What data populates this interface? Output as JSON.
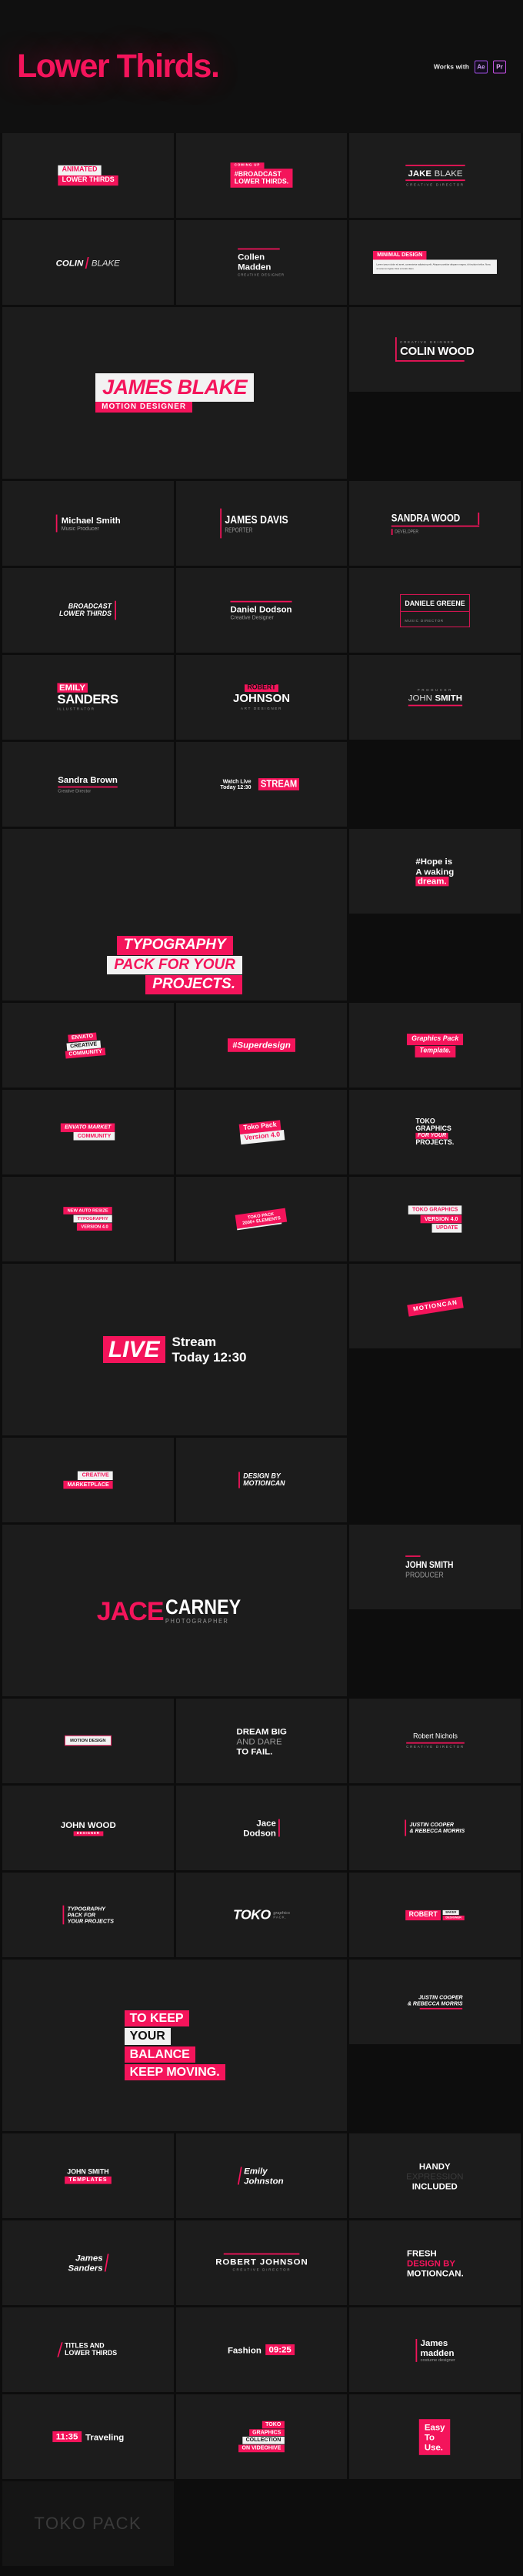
{
  "header": {
    "title": "Lower Thirds.",
    "works_with_label": "Works with",
    "badges": [
      {
        "name": "after-effects",
        "label": "Ae"
      },
      {
        "name": "premiere-pro",
        "label": "Pr"
      }
    ],
    "accent_color": "#f4145b",
    "background_color": "#0d0d0d"
  },
  "cards": {
    "animated_lower_thirds": {
      "line1": "ANIMATED",
      "line2": "LOWER THIRDS"
    },
    "broadcast_lower_thirds": {
      "kicker": "COMING UP",
      "line1": "#BROADCAST",
      "line2": "LOWER THIRDS."
    },
    "jake_blake": {
      "first": "JAKE",
      "last": "BLAKE",
      "role": "CREATIVE DIRECTOR"
    },
    "colin_blake": {
      "first": "COLIN",
      "last": "BLAKE"
    },
    "collen_madden": {
      "line1": "Collen",
      "line2": "Madden",
      "role": "CREATIVE DESIGNER"
    },
    "minimal_design": {
      "title": "MINIMAL DESIGN",
      "body": "Lorem ipsum dolor sit amet, consectetur adipiscing elit. Aliquam porttitor aliquam magna, id tincidunt tellus. Nunc sit amet ex ligula. Duis et tortor diam."
    },
    "james_blake": {
      "name": "JAMES BLAKE",
      "role": "MOTION DESIGNER"
    },
    "colin_wood": {
      "kicker": "CREATIVE DEIGNER",
      "name": "COLIN WOOD"
    },
    "michael_smith": {
      "name": "Michael Smith",
      "role": "Music Producer"
    },
    "james_davis": {
      "name": "JAMES DAVIS",
      "role": "REPORTER"
    },
    "sandra_wood": {
      "name": "SANDRA WOOD",
      "role": "DEVELOPER"
    },
    "broadcast_titles": {
      "line1": "BROADCAST",
      "line2": "LOWER THIRDS"
    },
    "daniel_dodson": {
      "name": "Daniel Dodson",
      "role": "Creative Designer"
    },
    "daniele_greene": {
      "name": "DANIELE GREENE",
      "role": "MUSIC DIRECTOR"
    },
    "emily_sanders": {
      "first": "EMILY",
      "last": "SANDERS",
      "role": "ILLUSTRATOR"
    },
    "robert_johnson_1": {
      "first": "ROBERT",
      "last": "JOHNSON",
      "role": "ART DESIGNER"
    },
    "john_smith_1": {
      "kicker": "PRODUCER",
      "first": "JOHN",
      "last": "SMITH"
    },
    "sandra_brown": {
      "name": "Sandra Brown",
      "role": "Creative Director"
    },
    "watch_live": {
      "line1": "Watch Live",
      "line2": "Today 12:30",
      "tag": "STREAM"
    },
    "typography_pack": {
      "line1": "TYPOGRAPHY",
      "line2": "PACK FOR YOUR",
      "line3": "PROJECTS."
    },
    "hope": {
      "line1": "#Hope is",
      "line2": "A waking",
      "line3": "dream."
    },
    "envato_creative": {
      "line1": "ENVATO",
      "line2": "CREATIVE",
      "line3": "COMMUNITY"
    },
    "superdesign": {
      "label": "#Superdesign"
    },
    "graphics_pack": {
      "line1": "Graphics Pack",
      "line2": "Template."
    },
    "envato_market": {
      "line1": "ENVATO MARKET",
      "line2": "COMMUNITY"
    },
    "toko_pack_version": {
      "line1": "Toko Pack",
      "line2": "Version 4.0"
    },
    "toko_graphics_projects": {
      "line1": "TOKO",
      "line2": "GRAPHICS",
      "line3": "FOR YOUR",
      "line4": "PROJECTS."
    },
    "new_auto_resize": {
      "line1": "NEW AUTO RESIZE",
      "line2": "TYPOGRAPHY",
      "line3": "VERSION 4.0"
    },
    "toko_pack_elements": {
      "line1": "TOKO PACK",
      "line2": "2000+ ELEMENTS"
    },
    "toko_graphics_update": {
      "line1": "TOKO GRAPHICS",
      "line2": "VERSION 4.0",
      "line3": "UPDATE"
    },
    "live_stream": {
      "badge": "LIVE",
      "line1": "Stream",
      "line2": "Today 12:30"
    },
    "motioncan_tag": {
      "label": "MOTIONCAN"
    },
    "creative_marketplace": {
      "line1": "CREATIVE",
      "line2": "MARKETPLACE"
    },
    "design_by_motioncan": {
      "line1": "DESIGN BY",
      "line2": "MOTIONCAN"
    },
    "jace_carney": {
      "first": "JACE",
      "last": "CARNEY",
      "role": "PHOTOGRAPHER"
    },
    "john_smith_2": {
      "name": "JOHN SMITH",
      "role": "PRODUCER"
    },
    "motion_design": {
      "label": "MOTION DESIGN"
    },
    "dream_big": {
      "line1": "DREAM BIG",
      "line2": "AND DARE",
      "line3": "TO FAIL."
    },
    "robert_nichols": {
      "name": "Robert Nichols",
      "role": "CREATIVE DIRECTOR"
    },
    "john_wood": {
      "name": "JOHN WOOD",
      "role": "DESIGNER"
    },
    "jace_dodson": {
      "line1": "Jace",
      "line2": "Dodson"
    },
    "justin_rebecca_1": {
      "line1": "JUSTIN COOPER",
      "line2": "& REBECCA MORRIS"
    },
    "typography_pack_projects": {
      "line1": "TYPOGRAPHY",
      "line2": "PACK FOR",
      "line3": "YOUR PROJECTS"
    },
    "toko_graphics_pack": {
      "line1": "TOKO",
      "line2": "graphics",
      "line3": "PACK."
    },
    "robert_badge": {
      "line1": "ROBERT",
      "tag1": "BAKER",
      "tag2": "DESIGNER"
    },
    "keep_balance": {
      "line1": "TO KEEP",
      "line2": "YOUR",
      "line3": "BALANCE",
      "line4": "KEEP MOVING."
    },
    "justin_rebecca_2": {
      "line1": "JUSTIN COOPER",
      "line2": "& REBECCA MORRIS"
    },
    "john_smith_templates": {
      "line1": "JOHN SMITH",
      "line2": "TEMPLATES"
    },
    "emily_johnston": {
      "line1": "Emily",
      "line2": "Johnston"
    },
    "handy_included": {
      "line1": "HANDY",
      "line2": "EXPRESSION",
      "line3": "INCLUDED"
    },
    "james_sanders": {
      "line1": "James",
      "line2": "Sanders"
    },
    "robert_johnson_2": {
      "name": "ROBERT JOHNSON",
      "role": "CREATIVE DIRECTOR"
    },
    "fresh_design": {
      "line1": "FRESH",
      "line2": "DESIGN BY",
      "line3": "MOTIONCAN."
    },
    "titles_lower_thirds": {
      "line1": "TITLES AND",
      "line2": "LOWER THIRDS"
    },
    "fashion": {
      "label": "Fashion",
      "time": "09:25"
    },
    "james_madden": {
      "line1": "James",
      "line2": "madden",
      "role": "costume designer"
    },
    "traveling": {
      "time": "11:35",
      "label": "Traveling"
    },
    "toko_collection": {
      "line1": "TOKO",
      "line2": "GRAPHICS",
      "line3": "COLLECTION",
      "line4": "ON VIDEOHIVE"
    },
    "easy_to_use": {
      "line1": "Easy",
      "line2": "To",
      "line3": "Use."
    },
    "watermark": {
      "label": "TOKO PACK"
    }
  }
}
